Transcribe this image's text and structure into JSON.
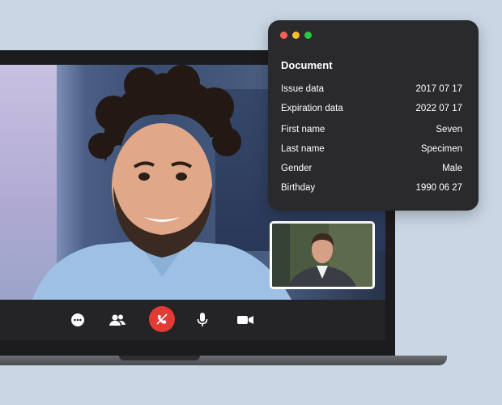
{
  "document_panel": {
    "title": "Document",
    "window_dots": [
      "#ff5f57",
      "#febc2e",
      "#28c840"
    ],
    "fields": [
      {
        "label": "Issue data",
        "value": "2017 07 17"
      },
      {
        "label": "Expiration data",
        "value": "2022 07 17"
      },
      {
        "label": "First name",
        "value": "Seven"
      },
      {
        "label": "Last name",
        "value": "Specimen"
      },
      {
        "label": "Gender",
        "value": "Male"
      },
      {
        "label": "Birthday",
        "value": "1990 06 27"
      }
    ]
  },
  "call_toolbar": {
    "buttons": [
      "more-icon",
      "participants-icon",
      "end-call-icon",
      "microphone-icon",
      "camera-icon"
    ],
    "end_call_color": "#e23b35"
  },
  "colors": {
    "background": "#c9d6e3",
    "panel": "#2a2a2c",
    "laptop": "#1c1c1e"
  }
}
